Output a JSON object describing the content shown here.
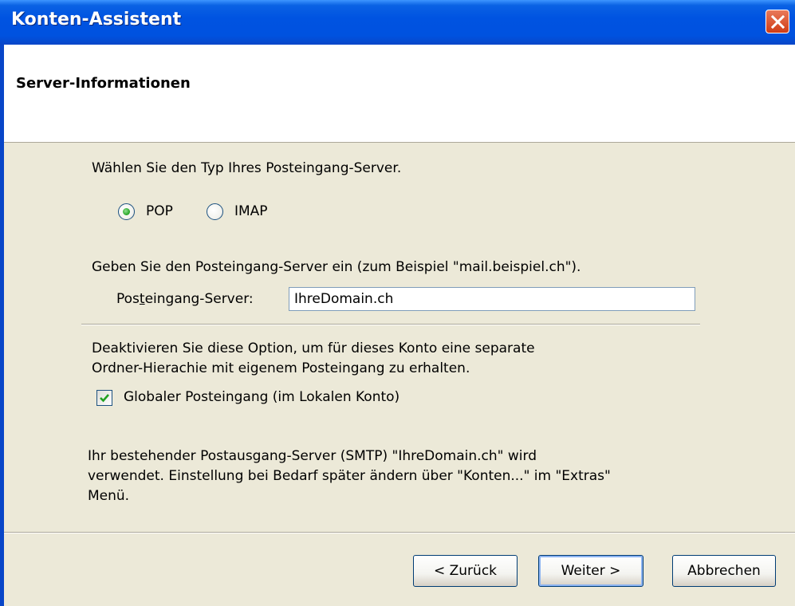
{
  "window": {
    "title": "Konten-Assistent"
  },
  "header": {
    "title": "Server-Informationen"
  },
  "server_type": {
    "prompt": "Wählen Sie den Typ Ihres Posteingang-Server.",
    "options": [
      {
        "label": "POP",
        "selected": true
      },
      {
        "label": "IMAP",
        "selected": false
      }
    ]
  },
  "incoming": {
    "prompt": "Geben Sie den Posteingang-Server ein (zum Beispiel \"mail.beispiel.ch\").",
    "label_pre": "Pos",
    "label_accel": "t",
    "label_post": "eingang-Server:",
    "value": "IhreDomain.ch"
  },
  "global_inbox": {
    "description_line1": "Deaktivieren Sie diese Option, um für dieses Konto eine separate",
    "description_line2": "Ordner-Hierachie mit eigenem Posteingang zu erhalten.",
    "checkbox_label": "Globaler Posteingang (im Lokalen Konto)",
    "checked": true
  },
  "smtp_info": {
    "line1": "Ihr bestehender Postausgang-Server (SMTP) \"IhreDomain.ch\" wird",
    "line2": "verwendet. Einstellung bei Bedarf später ändern über \"Konten...\" im \"Extras\"",
    "line3": "Menü."
  },
  "buttons": {
    "back": "< Zurück",
    "next": "Weiter >",
    "cancel": "Abbrechen"
  },
  "colors": {
    "titlebar": "#0053e1",
    "dialog_bg": "#ece9d8",
    "close_button": "#d03c15",
    "radio_selected": "#21a121",
    "checkmark": "#21a121"
  }
}
